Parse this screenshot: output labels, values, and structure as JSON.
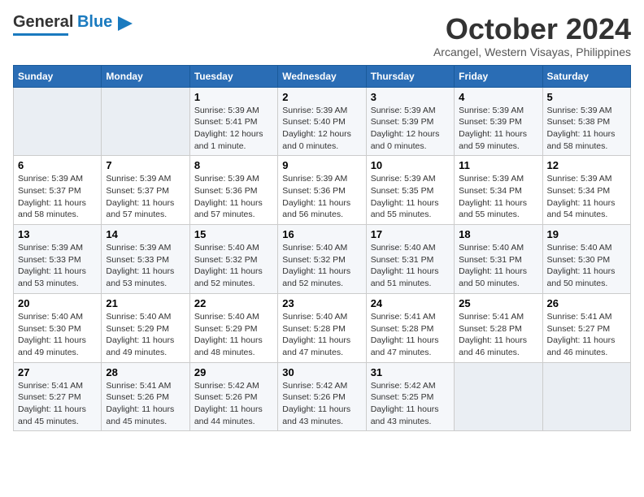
{
  "logo": {
    "text_general": "General",
    "text_blue": "Blue"
  },
  "header": {
    "month_year": "October 2024",
    "location": "Arcangel, Western Visayas, Philippines"
  },
  "weekdays": [
    "Sunday",
    "Monday",
    "Tuesday",
    "Wednesday",
    "Thursday",
    "Friday",
    "Saturday"
  ],
  "weeks": [
    [
      {
        "day": "",
        "empty": true
      },
      {
        "day": "",
        "empty": true
      },
      {
        "day": "1",
        "sunrise": "Sunrise: 5:39 AM",
        "sunset": "Sunset: 5:41 PM",
        "daylight": "Daylight: 12 hours and 1 minute."
      },
      {
        "day": "2",
        "sunrise": "Sunrise: 5:39 AM",
        "sunset": "Sunset: 5:40 PM",
        "daylight": "Daylight: 12 hours and 0 minutes."
      },
      {
        "day": "3",
        "sunrise": "Sunrise: 5:39 AM",
        "sunset": "Sunset: 5:39 PM",
        "daylight": "Daylight: 12 hours and 0 minutes."
      },
      {
        "day": "4",
        "sunrise": "Sunrise: 5:39 AM",
        "sunset": "Sunset: 5:39 PM",
        "daylight": "Daylight: 11 hours and 59 minutes."
      },
      {
        "day": "5",
        "sunrise": "Sunrise: 5:39 AM",
        "sunset": "Sunset: 5:38 PM",
        "daylight": "Daylight: 11 hours and 58 minutes."
      }
    ],
    [
      {
        "day": "6",
        "sunrise": "Sunrise: 5:39 AM",
        "sunset": "Sunset: 5:37 PM",
        "daylight": "Daylight: 11 hours and 58 minutes."
      },
      {
        "day": "7",
        "sunrise": "Sunrise: 5:39 AM",
        "sunset": "Sunset: 5:37 PM",
        "daylight": "Daylight: 11 hours and 57 minutes."
      },
      {
        "day": "8",
        "sunrise": "Sunrise: 5:39 AM",
        "sunset": "Sunset: 5:36 PM",
        "daylight": "Daylight: 11 hours and 57 minutes."
      },
      {
        "day": "9",
        "sunrise": "Sunrise: 5:39 AM",
        "sunset": "Sunset: 5:36 PM",
        "daylight": "Daylight: 11 hours and 56 minutes."
      },
      {
        "day": "10",
        "sunrise": "Sunrise: 5:39 AM",
        "sunset": "Sunset: 5:35 PM",
        "daylight": "Daylight: 11 hours and 55 minutes."
      },
      {
        "day": "11",
        "sunrise": "Sunrise: 5:39 AM",
        "sunset": "Sunset: 5:34 PM",
        "daylight": "Daylight: 11 hours and 55 minutes."
      },
      {
        "day": "12",
        "sunrise": "Sunrise: 5:39 AM",
        "sunset": "Sunset: 5:34 PM",
        "daylight": "Daylight: 11 hours and 54 minutes."
      }
    ],
    [
      {
        "day": "13",
        "sunrise": "Sunrise: 5:39 AM",
        "sunset": "Sunset: 5:33 PM",
        "daylight": "Daylight: 11 hours and 53 minutes."
      },
      {
        "day": "14",
        "sunrise": "Sunrise: 5:39 AM",
        "sunset": "Sunset: 5:33 PM",
        "daylight": "Daylight: 11 hours and 53 minutes."
      },
      {
        "day": "15",
        "sunrise": "Sunrise: 5:40 AM",
        "sunset": "Sunset: 5:32 PM",
        "daylight": "Daylight: 11 hours and 52 minutes."
      },
      {
        "day": "16",
        "sunrise": "Sunrise: 5:40 AM",
        "sunset": "Sunset: 5:32 PM",
        "daylight": "Daylight: 11 hours and 52 minutes."
      },
      {
        "day": "17",
        "sunrise": "Sunrise: 5:40 AM",
        "sunset": "Sunset: 5:31 PM",
        "daylight": "Daylight: 11 hours and 51 minutes."
      },
      {
        "day": "18",
        "sunrise": "Sunrise: 5:40 AM",
        "sunset": "Sunset: 5:31 PM",
        "daylight": "Daylight: 11 hours and 50 minutes."
      },
      {
        "day": "19",
        "sunrise": "Sunrise: 5:40 AM",
        "sunset": "Sunset: 5:30 PM",
        "daylight": "Daylight: 11 hours and 50 minutes."
      }
    ],
    [
      {
        "day": "20",
        "sunrise": "Sunrise: 5:40 AM",
        "sunset": "Sunset: 5:30 PM",
        "daylight": "Daylight: 11 hours and 49 minutes."
      },
      {
        "day": "21",
        "sunrise": "Sunrise: 5:40 AM",
        "sunset": "Sunset: 5:29 PM",
        "daylight": "Daylight: 11 hours and 49 minutes."
      },
      {
        "day": "22",
        "sunrise": "Sunrise: 5:40 AM",
        "sunset": "Sunset: 5:29 PM",
        "daylight": "Daylight: 11 hours and 48 minutes."
      },
      {
        "day": "23",
        "sunrise": "Sunrise: 5:40 AM",
        "sunset": "Sunset: 5:28 PM",
        "daylight": "Daylight: 11 hours and 47 minutes."
      },
      {
        "day": "24",
        "sunrise": "Sunrise: 5:41 AM",
        "sunset": "Sunset: 5:28 PM",
        "daylight": "Daylight: 11 hours and 47 minutes."
      },
      {
        "day": "25",
        "sunrise": "Sunrise: 5:41 AM",
        "sunset": "Sunset: 5:28 PM",
        "daylight": "Daylight: 11 hours and 46 minutes."
      },
      {
        "day": "26",
        "sunrise": "Sunrise: 5:41 AM",
        "sunset": "Sunset: 5:27 PM",
        "daylight": "Daylight: 11 hours and 46 minutes."
      }
    ],
    [
      {
        "day": "27",
        "sunrise": "Sunrise: 5:41 AM",
        "sunset": "Sunset: 5:27 PM",
        "daylight": "Daylight: 11 hours and 45 minutes."
      },
      {
        "day": "28",
        "sunrise": "Sunrise: 5:41 AM",
        "sunset": "Sunset: 5:26 PM",
        "daylight": "Daylight: 11 hours and 45 minutes."
      },
      {
        "day": "29",
        "sunrise": "Sunrise: 5:42 AM",
        "sunset": "Sunset: 5:26 PM",
        "daylight": "Daylight: 11 hours and 44 minutes."
      },
      {
        "day": "30",
        "sunrise": "Sunrise: 5:42 AM",
        "sunset": "Sunset: 5:26 PM",
        "daylight": "Daylight: 11 hours and 43 minutes."
      },
      {
        "day": "31",
        "sunrise": "Sunrise: 5:42 AM",
        "sunset": "Sunset: 5:25 PM",
        "daylight": "Daylight: 11 hours and 43 minutes."
      },
      {
        "day": "",
        "empty": true
      },
      {
        "day": "",
        "empty": true
      }
    ]
  ]
}
